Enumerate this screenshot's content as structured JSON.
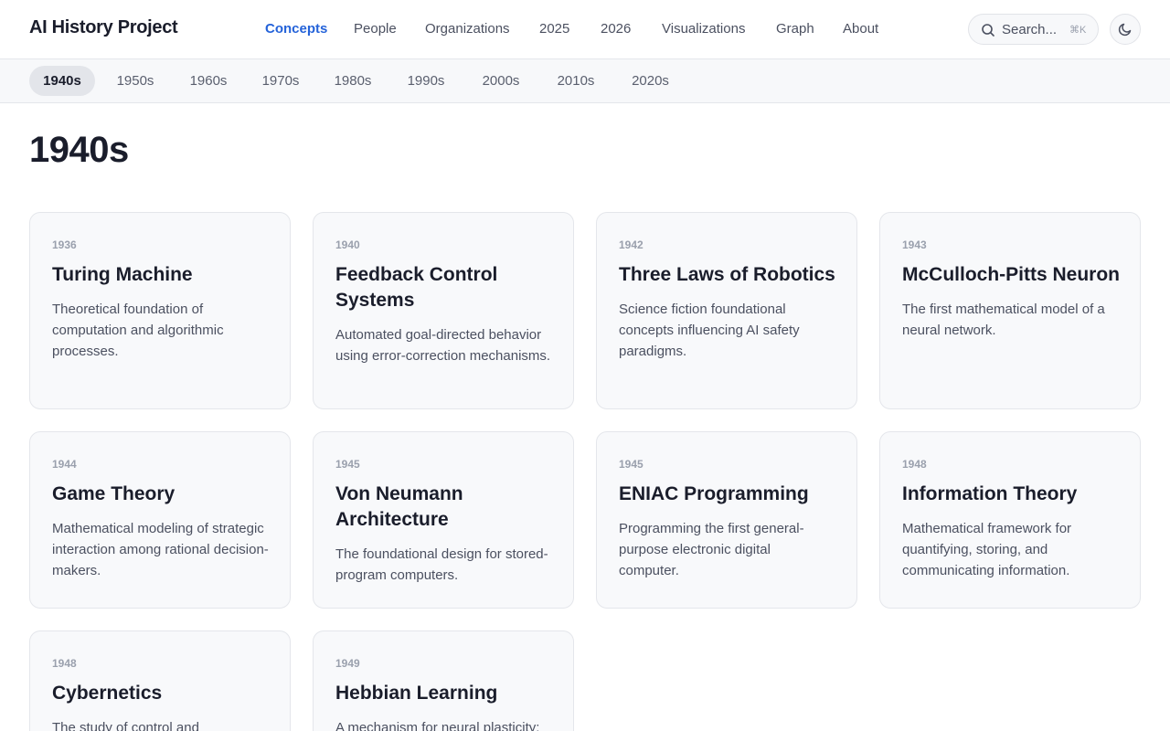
{
  "header": {
    "brand": "AI History Project",
    "nav": [
      {
        "label": "Concepts",
        "active": true
      },
      {
        "label": "People",
        "active": false
      },
      {
        "label": "Organizations",
        "active": false
      },
      {
        "label": "2025",
        "active": false
      },
      {
        "label": "2026",
        "active": false
      },
      {
        "label": "Visualizations",
        "active": false
      },
      {
        "label": "Graph",
        "active": false
      },
      {
        "label": "About",
        "active": false
      }
    ],
    "search": {
      "placeholder": "Search...",
      "shortcut": "⌘K",
      "icon": "search-icon"
    },
    "theme_toggle": {
      "icon": "moon-icon"
    }
  },
  "decades": [
    {
      "label": "1940s",
      "active": true
    },
    {
      "label": "1950s",
      "active": false
    },
    {
      "label": "1960s",
      "active": false
    },
    {
      "label": "1970s",
      "active": false
    },
    {
      "label": "1980s",
      "active": false
    },
    {
      "label": "1990s",
      "active": false
    },
    {
      "label": "2000s",
      "active": false
    },
    {
      "label": "2010s",
      "active": false
    },
    {
      "label": "2020s",
      "active": false
    }
  ],
  "main": {
    "title": "1940s",
    "cards": [
      {
        "year": "1936",
        "title": "Turing Machine",
        "description": "Theoretical foundation of computation and algorithmic processes."
      },
      {
        "year": "1940",
        "title": "Feedback Control Systems",
        "description": "Automated goal-directed behavior using error-correction mechanisms."
      },
      {
        "year": "1942",
        "title": "Three Laws of Robotics",
        "description": "Science fiction foundational concepts influencing AI safety paradigms."
      },
      {
        "year": "1943",
        "title": "McCulloch-Pitts Neuron",
        "description": "The first mathematical model of a neural network."
      },
      {
        "year": "1944",
        "title": "Game Theory",
        "description": "Mathematical modeling of strategic interaction among rational decision-makers."
      },
      {
        "year": "1945",
        "title": "Von Neumann Architecture",
        "description": "The foundational design for stored-program computers."
      },
      {
        "year": "1945",
        "title": "ENIAC Programming",
        "description": "Programming the first general-purpose electronic digital computer."
      },
      {
        "year": "1948",
        "title": "Information Theory",
        "description": "Mathematical framework for quantifying, storing, and communicating information."
      },
      {
        "year": "1948",
        "title": "Cybernetics",
        "description": "The study of control and"
      },
      {
        "year": "1949",
        "title": "Hebbian Learning",
        "description": "A mechanism for neural plasticity:"
      }
    ]
  },
  "colors": {
    "accent": "#2563d9",
    "text": "#1a1d2b",
    "muted": "#4b5060",
    "card_bg": "#f8f9fb",
    "border": "#e4e6eb"
  }
}
